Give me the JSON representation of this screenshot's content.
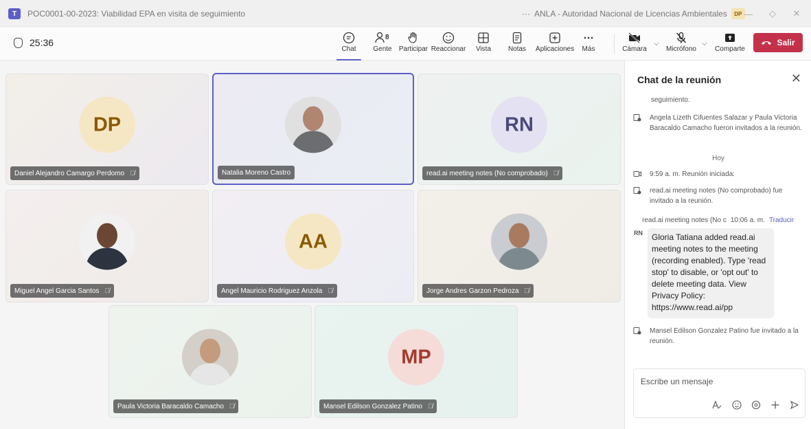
{
  "window": {
    "title": "POC0001-00-2023: Viabilidad EPA en visita de seguimiento",
    "ellipsis": "···",
    "org": "ANLA - Autoridad Nacional de Licencias Ambientales",
    "user_initials": "DP",
    "minimize": "—",
    "restore": "◇",
    "close": "✕"
  },
  "toolbar": {
    "timer": "25:36",
    "people_count": "8",
    "buttons": [
      {
        "label": "Chat",
        "icon": "chat-icon"
      },
      {
        "label": "Gente",
        "icon": "people-icon"
      },
      {
        "label": "Participar",
        "icon": "raise-hand-icon"
      },
      {
        "label": "Reaccionar",
        "icon": "smiley-icon"
      },
      {
        "label": "Vista",
        "icon": "grid-icon"
      },
      {
        "label": "Notas",
        "icon": "notes-icon"
      },
      {
        "label": "Aplicaciones",
        "icon": "plus-square-icon"
      },
      {
        "label": "Más",
        "icon": "more-icon"
      },
      {
        "label": "Cámara",
        "icon": "camera-off-icon"
      },
      {
        "label": "Micrófono",
        "icon": "mic-off-icon"
      },
      {
        "label": "Comparte",
        "icon": "share-icon"
      }
    ],
    "leave_label": "Salir",
    "accent": "#5b5fc7",
    "leave_color": "#c4314b"
  },
  "participants": [
    {
      "name": "Daniel Alejandro Camargo Perdomo",
      "initials": "DP",
      "muted": true,
      "avatar_bg": "#f6e7c4",
      "avatar_fg": "#8a5a00"
    },
    {
      "name": "Natalia Moreno Castro",
      "initials": "",
      "muted": false,
      "active_speaker": true
    },
    {
      "name": "read.ai meeting notes (No comprobado)",
      "initials": "RN",
      "muted": true,
      "avatar_bg": "#e4e2f2",
      "avatar_fg": "#4b4b7a"
    },
    {
      "name": "Miguel Angel Garcia Santos",
      "initials": "",
      "muted": true
    },
    {
      "name": "Angel Mauricio Rodriguez Anzola",
      "initials": "AA",
      "muted": true,
      "avatar_bg": "#f6e7c4",
      "avatar_fg": "#8a5a00"
    },
    {
      "name": "Jorge Andres Garzon Pedroza",
      "initials": "",
      "muted": true
    },
    {
      "name": "Paula Victoria Baracaldo Camacho",
      "initials": "",
      "muted": true
    },
    {
      "name": "Mansel Edilson Gonzalez Patino",
      "initials": "MP",
      "muted": true,
      "avatar_bg": "#f6dcd8",
      "avatar_fg": "#a33a2e"
    }
  ],
  "chat": {
    "title": "Chat de la reunión",
    "close_glyph": "✕",
    "items": [
      {
        "text": "seguimiento."
      },
      {
        "text": "Angela Lizeth Cifuentes Salazar y Paula Victoria Baracaldo Camacho fueron invitados a la reunión."
      },
      {
        "text": "Hoy"
      },
      {
        "text": "9:59 a. m.   Reunión iniciada:"
      },
      {
        "text": "read.ai meeting notes (No comprobado) fue invitado a la reunión."
      },
      {
        "text": "Mansel Edilson Gonzalez Patino fue invitado a la reunión."
      }
    ],
    "message": {
      "sender": "read.ai meeting notes (No c",
      "time": "10:06 a. m.",
      "translate": "Traducir",
      "badge": "RN",
      "text": "Gloria Tatiana added read.ai meeting notes to the meeting (recording enabled). Type 'read stop' to disable, or 'opt out' to delete meeting data. View Privacy Policy: https://www.read.ai/pp"
    },
    "composer_placeholder": "Escribe un mensaje"
  }
}
